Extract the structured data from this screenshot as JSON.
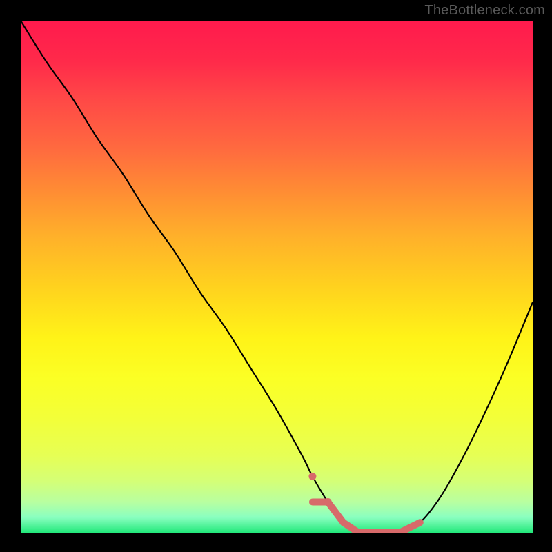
{
  "watermark": "TheBottleneck.com",
  "chart_data": {
    "type": "line",
    "title": "",
    "xlabel": "",
    "ylabel": "",
    "xlim": [
      0,
      100
    ],
    "ylim": [
      0,
      100
    ],
    "grid": false,
    "axes_visible": false,
    "background": "rainbow-gradient",
    "series": [
      {
        "name": "bottleneck-curve",
        "x": [
          0,
          5,
          10,
          15,
          20,
          25,
          30,
          35,
          40,
          45,
          50,
          55,
          57,
          60,
          63,
          66,
          70,
          74,
          78,
          82,
          86,
          90,
          95,
          100
        ],
        "values": [
          100,
          92,
          85,
          77,
          70,
          62,
          55,
          47,
          40,
          32,
          24,
          15,
          11,
          6,
          2,
          0,
          0,
          0,
          2,
          7,
          14,
          22,
          33,
          45
        ]
      }
    ],
    "optimal_zone": {
      "x_start": 57,
      "x_end": 78,
      "value_threshold": 6
    },
    "markers": [
      {
        "x": 57,
        "y": 11,
        "shape": "dot"
      },
      {
        "x": 60,
        "y": 6,
        "shape": "dot"
      }
    ]
  }
}
